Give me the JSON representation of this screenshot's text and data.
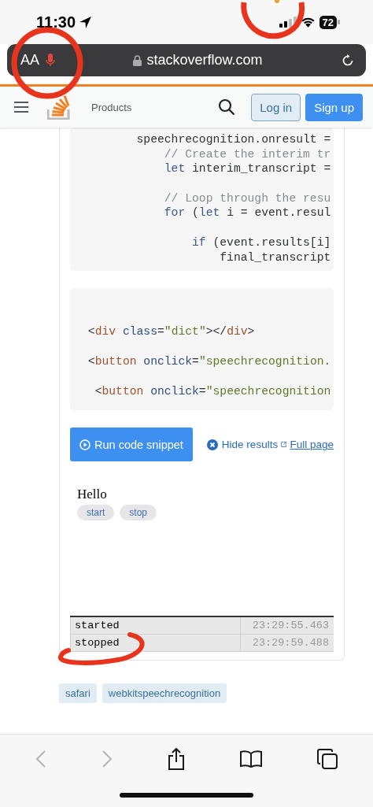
{
  "status_bar": {
    "time": "11:30",
    "battery": "72"
  },
  "address_bar": {
    "text_size_button": "AA",
    "microphone_active": true,
    "url": "stackoverflow.com"
  },
  "header": {
    "products": "Products",
    "login": "Log in",
    "signup": "Sign up"
  },
  "code_blocks": [
    {
      "lines": [
        {
          "kind": "code",
          "tokens": [
            {
              "kind": "plain",
              "text": "speechrecognition.onresult ="
            }
          ],
          "children": [
            {
              "kind": "code",
              "tokens": [
                {
                  "kind": "comment",
                  "text": "// Create the interim tr"
                }
              ]
            },
            {
              "kind": "code",
              "tokens": [
                {
                  "kind": "keyword",
                  "text": "let"
                },
                {
                  "kind": "plain",
                  "text": " interim_transcript ="
                }
              ]
            },
            {
              "kind": "blank"
            },
            {
              "kind": "code",
              "tokens": [
                {
                  "kind": "comment",
                  "text": "// Loop through the resu"
                }
              ]
            },
            {
              "kind": "code",
              "tokens": [
                {
                  "kind": "keyword",
                  "text": "for"
                },
                {
                  "kind": "plain",
                  "text": " ("
                },
                {
                  "kind": "keyword",
                  "text": "let"
                },
                {
                  "kind": "plain",
                  "text": " i = event.resul"
                }
              ],
              "children": [
                {
                  "kind": "blank"
                },
                {
                  "kind": "code",
                  "tokens": [
                    {
                      "kind": "keyword",
                      "text": "if"
                    },
                    {
                      "kind": "plain",
                      "text": " (event.results[i]"
                    }
                  ],
                  "children": [
                    {
                      "kind": "code",
                      "tokens": [
                        {
                          "kind": "plain",
                          "text": "final_transcript"
                        }
                      ]
                    }
                  ]
                }
              ]
            }
          ]
        }
      ]
    },
    {
      "lines": [
        {
          "kind": "blank"
        },
        {
          "kind": "blank"
        },
        {
          "kind": "code",
          "tokens": [
            {
              "kind": "plain",
              "text": " <"
            },
            {
              "kind": "tag",
              "text": "div"
            },
            {
              "kind": "attr",
              "text": " class"
            },
            {
              "kind": "plain",
              "text": "="
            },
            {
              "kind": "string",
              "text": "\"dict\""
            },
            {
              "kind": "plain",
              "text": "></"
            },
            {
              "kind": "tag",
              "text": "div"
            },
            {
              "kind": "plain",
              "text": ">"
            }
          ]
        },
        {
          "kind": "blank"
        },
        {
          "kind": "code",
          "tokens": [
            {
              "kind": "plain",
              "text": " <"
            },
            {
              "kind": "tag",
              "text": "button"
            },
            {
              "kind": "attr",
              "text": " onclick"
            },
            {
              "kind": "plain",
              "text": "="
            },
            {
              "kind": "string",
              "text": "\"speechrecognition."
            }
          ]
        },
        {
          "kind": "blank"
        },
        {
          "kind": "code",
          "tokens": [
            {
              "kind": "plain",
              "text": "  <"
            },
            {
              "kind": "tag",
              "text": "button"
            },
            {
              "kind": "attr",
              "text": " onclick"
            },
            {
              "kind": "plain",
              "text": "="
            },
            {
              "kind": "string",
              "text": "\"speechrecognition"
            }
          ]
        }
      ]
    }
  ],
  "snippet_actions": {
    "run": "Run code snippet",
    "hide": "Hide results",
    "full_page": "Full page"
  },
  "result": {
    "greeting": "Hello",
    "buttons": [
      "start",
      "stop"
    ],
    "log": [
      {
        "event": "started",
        "time": "23:29:55.463"
      },
      {
        "event": "stopped",
        "time": "23:29:59.488"
      }
    ]
  },
  "tags": [
    "safari",
    "webkitspeechrecognition"
  ],
  "toolbar": [
    {
      "kind": "back",
      "disabled": true
    },
    {
      "kind": "forward",
      "disabled": true
    },
    {
      "kind": "share",
      "disabled": false
    },
    {
      "kind": "bookmarks",
      "disabled": false
    },
    {
      "kind": "tabs",
      "disabled": false
    }
  ]
}
